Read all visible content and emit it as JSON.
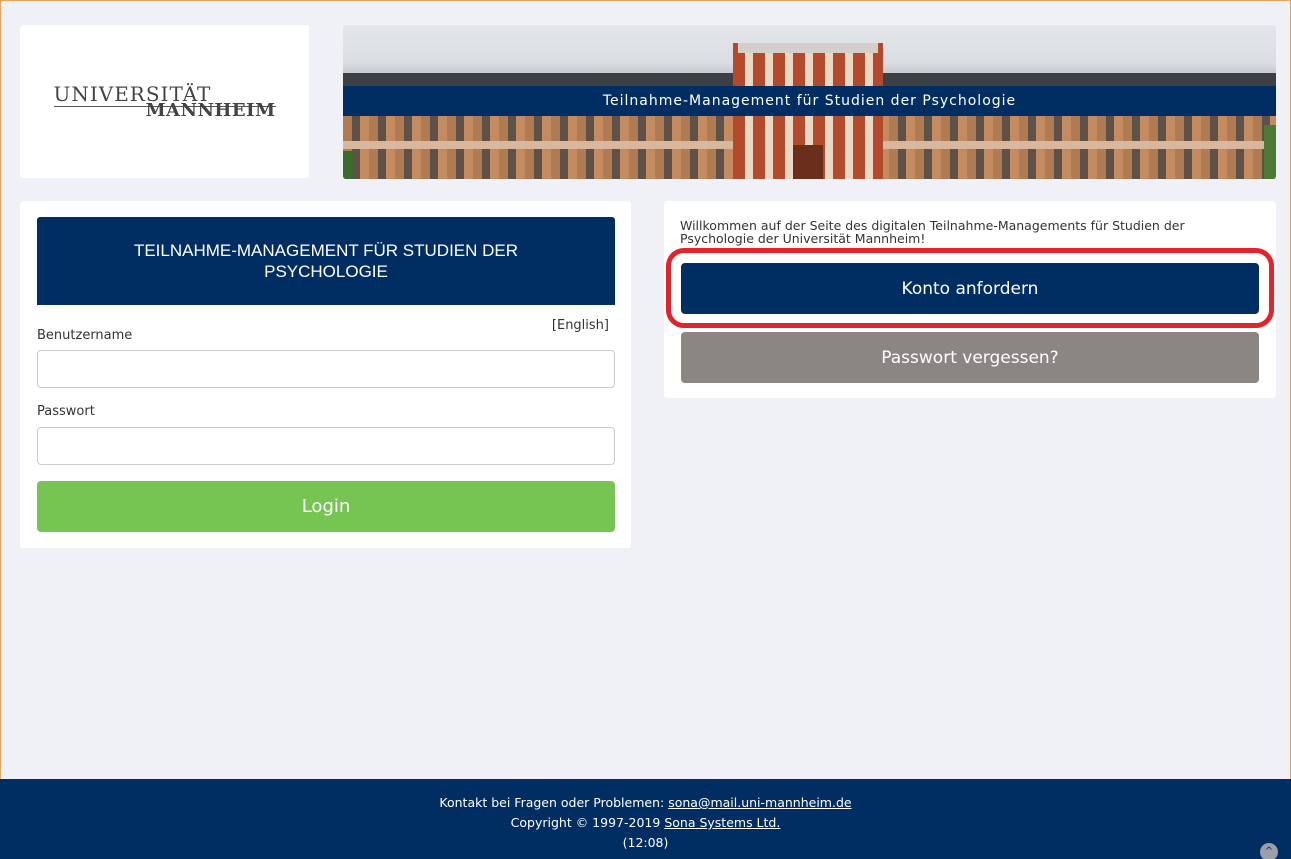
{
  "logo": {
    "line1": "UNIVERSITÄT",
    "line2": "MANNHEIM"
  },
  "banner": {
    "title": "Teilnahme-Management für Studien der Psychologie"
  },
  "login": {
    "heading": "TEILNAHME-MANAGEMENT FÜR STUDIEN DER PSYCHOLOGIE",
    "language_link": "[English]",
    "username_label": "Benutzername",
    "username_value": "",
    "password_label": "Passwort",
    "password_value": "",
    "login_button": "Login"
  },
  "side": {
    "welcome_text": "Willkommen auf der Seite des digitalen Teilnahme-Managements für Studien der Psychologie der Universität Mannheim!",
    "request_account_button": "Konto anfordern",
    "forgot_password_button": "Passwort vergessen?"
  },
  "footer": {
    "contact_prefix": "Kontakt bei Fragen oder Problemen:",
    "contact_email": "sona@mail.uni-mannheim.de",
    "copyright_prefix": "Copyright © 1997-2019",
    "company_link": "Sona Systems Ltd.",
    "time": "(12:08)"
  },
  "colors": {
    "navy": "#002d62",
    "login_green": "#76c552",
    "forgot_gray": "#8b8684",
    "highlight_red": "#e32329",
    "page_bg": "#f0f1f6"
  },
  "icons": {
    "scroll_top": "chevron-up-icon"
  }
}
